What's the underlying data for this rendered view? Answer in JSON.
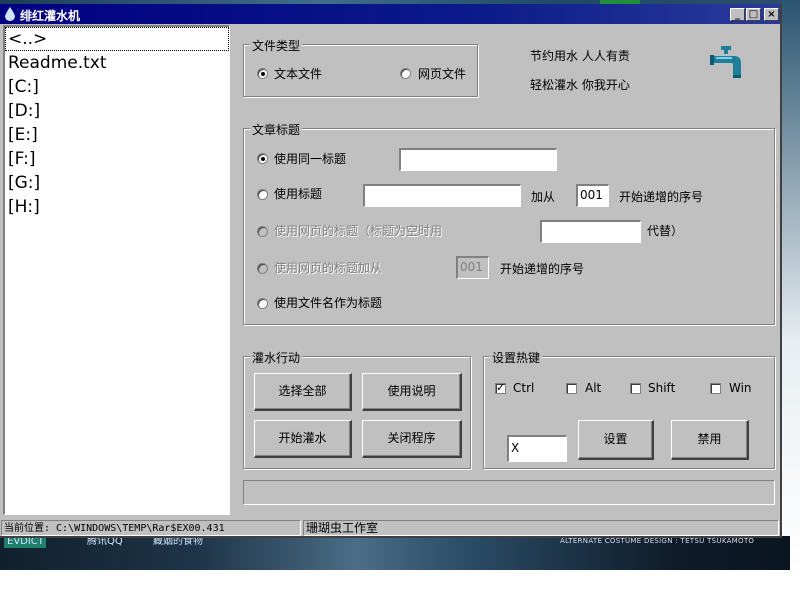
{
  "window": {
    "title": "绯红灌水机",
    "min_glyph": "_",
    "max_glyph": "□",
    "close_glyph": "×"
  },
  "file_list": {
    "items": [
      "<..>",
      "Readme.txt",
      "[C:]",
      "[D:]",
      "[E:]",
      "[F:]",
      "[G:]",
      "[H:]"
    ]
  },
  "file_type": {
    "title": "文件类型",
    "text_file": "文本文件",
    "web_file": "网页文件",
    "selected": "text_file"
  },
  "slogans": {
    "line1": "节约用水  人人有责",
    "line2": "轻松灌水  你我开心",
    "icon": "water-faucet-icon"
  },
  "article": {
    "title": "文章标题",
    "same_title": "使用同一标题",
    "same_title_value": "",
    "use_title": "使用标题",
    "use_title_value": "",
    "add_from": "加从",
    "seq_value": "001",
    "seq_suffix": "开始递增的序号",
    "web_title": "使用网页的标题（标题为空时用",
    "web_title_value": "",
    "web_title_suffix": "代替）",
    "web_title_add": "使用网页的标题加从",
    "web_seq_value": "001",
    "web_seq_suffix": "开始递增的序号",
    "filename_title": "使用文件名作为标题",
    "selected": "same_title"
  },
  "actions": {
    "title": "灌水行动",
    "select_all": "选择全部",
    "instructions": "使用说明",
    "start": "开始灌水",
    "close": "关闭程序"
  },
  "hotkey": {
    "title": "设置热键",
    "ctrl": "Ctrl",
    "alt": "Alt",
    "shift": "Shift",
    "win": "Win",
    "ctrl_checked": true,
    "alt_checked": false,
    "shift_checked": false,
    "win_checked": false,
    "key_value": "X",
    "set": "设置",
    "disable": "禁用"
  },
  "status": {
    "path": "当前位置: C:\\WINDOWS\\TEMP\\Rar$EX00.431",
    "studio": "珊瑚虫工作室"
  },
  "desktop": {
    "label1": "EVDICT",
    "label2": "腾讯QQ",
    "label3": "藏姻的食物",
    "credit": "ALTERNATE COSTUME DESIGN : TETSU TSUKAMOTO"
  },
  "colors": {
    "titlebar": "#000080",
    "window_bg": "#c0c0c0",
    "faucet": "#1f7f9a"
  }
}
